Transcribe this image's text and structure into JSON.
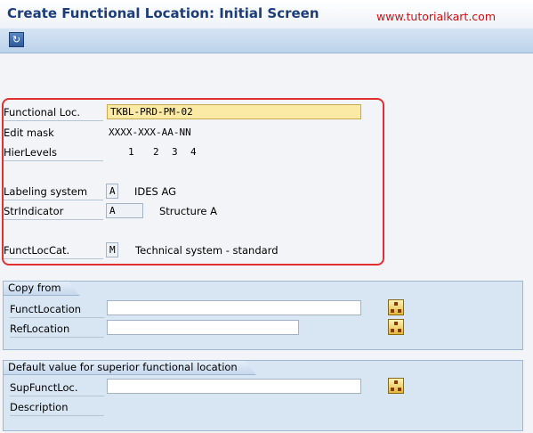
{
  "header": {
    "title": "Create Functional Location: Initial Screen",
    "brand": "www.tutorialkart.com"
  },
  "toolbar": {
    "icons": [
      "refresh-icon"
    ]
  },
  "main": {
    "functional_loc": {
      "label": "Functional Loc.",
      "value": "TKBL-PRD-PM-02"
    },
    "edit_mask": {
      "label": "Edit mask",
      "value": "XXXX-XXX-AA-NN"
    },
    "hier_levels": {
      "label": "HierLevels",
      "levels": [
        "1",
        "2",
        "3",
        "4"
      ]
    },
    "labeling_system": {
      "label": "Labeling system",
      "value": "A",
      "description": "IDES AG"
    },
    "str_indicator": {
      "label": "StrIndicator",
      "value": "A",
      "description": "Structure A"
    },
    "funct_loc_cat": {
      "label": "FunctLocCat.",
      "value": "M",
      "description": "Technical system - standard"
    }
  },
  "copy_from": {
    "title": "Copy from",
    "funct_location": {
      "label": "FunctLocation",
      "value": ""
    },
    "ref_location": {
      "label": "RefLocation",
      "value": ""
    }
  },
  "superior": {
    "title": "Default value for superior functional location",
    "sup_funct_loc": {
      "label": "SupFunctLoc.",
      "value": ""
    },
    "description": {
      "label": "Description",
      "value": ""
    }
  },
  "colors": {
    "title": "#1c3d7a",
    "brand": "#d01010",
    "highlight_border": "#e03030",
    "active_field": "#fbe9a6"
  }
}
